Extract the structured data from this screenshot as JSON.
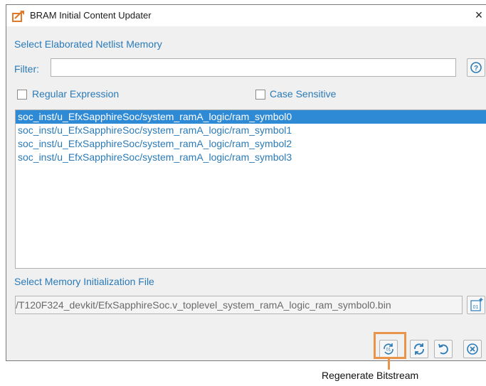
{
  "window": {
    "title": "BRAM Initial Content Updater",
    "close_glyph": "×",
    "app_icon": "bram-updater-icon"
  },
  "netlist": {
    "section_label": "Select Elaborated Netlist Memory",
    "filter_label": "Filter:",
    "filter_value": "",
    "help_icon": "help-circle-icon",
    "regex_label": "Regular Expression",
    "regex_checked": false,
    "case_label": "Case Sensitive",
    "case_checked": false,
    "items": [
      "soc_inst/u_EfxSapphireSoc/system_ramA_logic/ram_symbol0",
      "soc_inst/u_EfxSapphireSoc/system_ramA_logic/ram_symbol1",
      "soc_inst/u_EfxSapphireSoc/system_ramA_logic/ram_symbol2",
      "soc_inst/u_EfxSapphireSoc/system_ramA_logic/ram_symbol3"
    ],
    "selected_index": 0
  },
  "memory_file": {
    "section_label": "Select Memory Initialization File",
    "path_value": "/T120F324_devkit/EfxSapphireSoc.v_toplevel_system_ramA_logic_ram_symbol0.bin",
    "browse_icon": "binary-file-add-icon"
  },
  "actions": {
    "regenerate_icon": "regenerate-bitstream-icon",
    "refresh_icon": "refresh-icon",
    "undo_icon": "undo-icon",
    "cancel_icon": "cancel-circle-icon"
  },
  "annotation": {
    "callout_label": "Regenerate Bitstream",
    "highlight_color": "#e8954a"
  },
  "colors": {
    "accent_text": "#2a7ab8",
    "selection_bg": "#2f8ad6"
  }
}
